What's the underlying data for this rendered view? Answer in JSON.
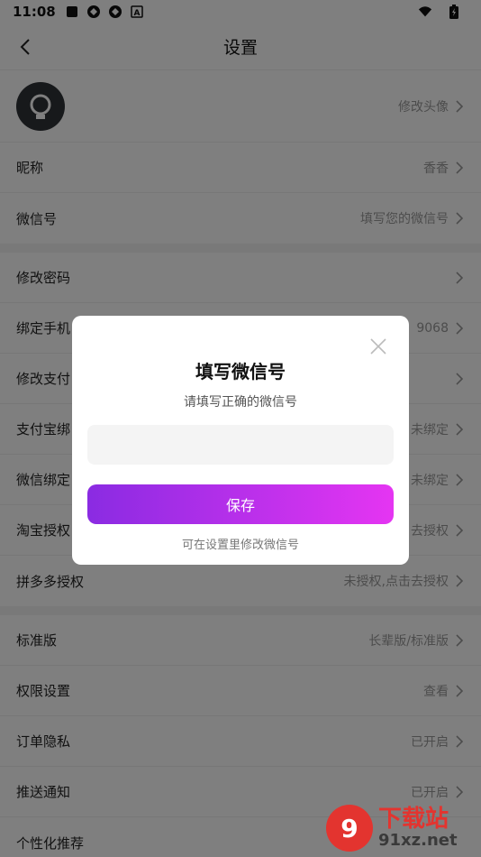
{
  "status_bar": {
    "time": "11:08",
    "icons": [
      "square-icon",
      "sync-icon",
      "sync-icon",
      "a-box-icon"
    ],
    "right_icons": [
      "wifi-icon",
      "battery-icon"
    ]
  },
  "nav": {
    "title": "设置",
    "back_icon": "back-arrow-icon"
  },
  "avatar_row": {
    "value": "修改头像"
  },
  "group1": [
    {
      "label": "昵称",
      "value": "香香"
    },
    {
      "label": "微信号",
      "value": "填写您的微信号"
    }
  ],
  "group2": [
    {
      "label": "修改密码",
      "value": ""
    },
    {
      "label": "绑定手机",
      "value": "9068"
    },
    {
      "label": "修改支付",
      "value": ""
    },
    {
      "label": "支付宝绑",
      "value": "未绑定"
    },
    {
      "label": "微信绑定",
      "value": "未绑定"
    },
    {
      "label": "淘宝授权",
      "value": "去授权"
    },
    {
      "label": "拼多多授权",
      "value": "未授权,点击去授权"
    }
  ],
  "group3": [
    {
      "label": "标准版",
      "value": "长辈版/标准版"
    },
    {
      "label": "权限设置",
      "value": "查看"
    },
    {
      "label": "订单隐私",
      "value": "已开启"
    },
    {
      "label": "推送通知",
      "value": "已开启"
    },
    {
      "label": "个性化推荐",
      "value": ""
    }
  ],
  "dialog": {
    "title": "填写微信号",
    "subtitle": "请填写正确的微信号",
    "input_value": "",
    "save_label": "保存",
    "hint": "可在设置里修改微信号",
    "close_icon": "close-icon",
    "save_gradient": [
      "#8a2be2",
      "#e535f2"
    ]
  },
  "watermark": {
    "cn": "下载站",
    "url": "91xz.net"
  }
}
